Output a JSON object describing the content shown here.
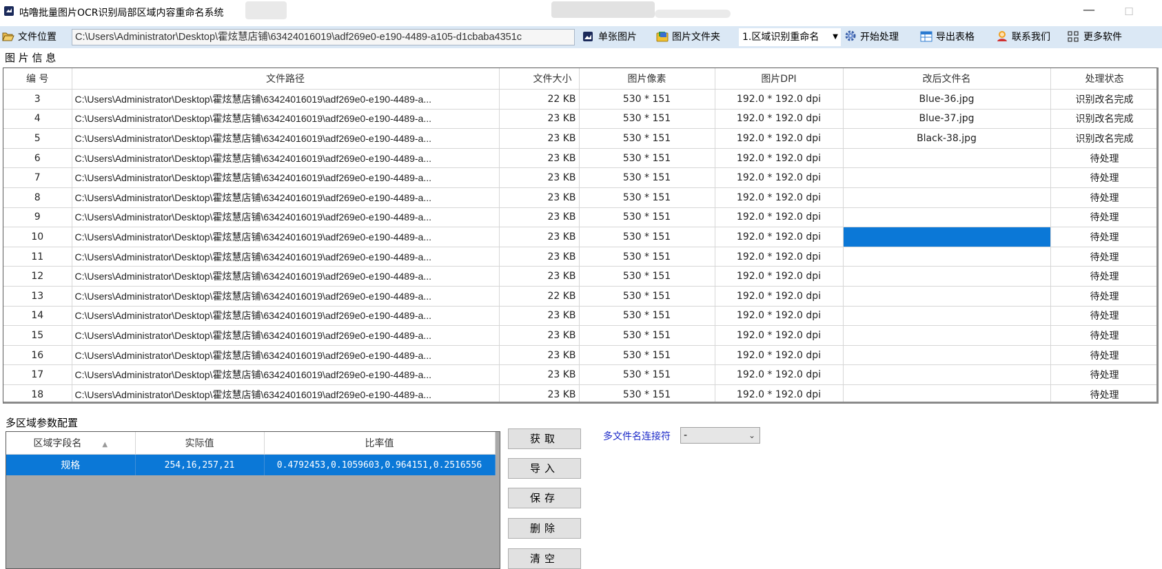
{
  "window": {
    "title": "咕噜批量图片OCR识别局部区域内容重命名系统",
    "min_glyph": "—",
    "max_glyph": "☐"
  },
  "toolbar": {
    "file_location_label": "文件位置",
    "path_value": "C:\\Users\\Administrator\\Desktop\\霍炫慧店铺\\63424016019\\adf269e0-e190-4489-a105-d1cbaba4351c",
    "single_image_label": "单张图片",
    "image_folder_label": "图片文件夹",
    "mode_value": "1.区域识别重命名",
    "start_label": "开始处理",
    "export_label": "导出表格",
    "contact_label": "联系我们",
    "more_label": "更多软件"
  },
  "image_info": {
    "section_title": "图 片 信 息",
    "columns": [
      "编 号",
      "文件路径",
      "文件大小",
      "图片像素",
      "图片DPI",
      "改后文件名",
      "处理状态"
    ],
    "rows": [
      {
        "num": "3",
        "path": "C:\\Users\\Administrator\\Desktop\\霍炫慧店铺\\63424016019\\adf269e0-e190-4489-a...",
        "size": "22 KB",
        "pixels": "530 * 151",
        "dpi": "192.0 * 192.0 dpi",
        "new_name": "Blue-36.jpg",
        "status": "识别改名完成"
      },
      {
        "num": "4",
        "path": "C:\\Users\\Administrator\\Desktop\\霍炫慧店铺\\63424016019\\adf269e0-e190-4489-a...",
        "size": "23 KB",
        "pixels": "530 * 151",
        "dpi": "192.0 * 192.0 dpi",
        "new_name": "Blue-37.jpg",
        "status": "识别改名完成"
      },
      {
        "num": "5",
        "path": "C:\\Users\\Administrator\\Desktop\\霍炫慧店铺\\63424016019\\adf269e0-e190-4489-a...",
        "size": "23 KB",
        "pixels": "530 * 151",
        "dpi": "192.0 * 192.0 dpi",
        "new_name": "Black-38.jpg",
        "status": "识别改名完成"
      },
      {
        "num": "6",
        "path": "C:\\Users\\Administrator\\Desktop\\霍炫慧店铺\\63424016019\\adf269e0-e190-4489-a...",
        "size": "23 KB",
        "pixels": "530 * 151",
        "dpi": "192.0 * 192.0 dpi",
        "new_name": "",
        "status": "待处理"
      },
      {
        "num": "7",
        "path": "C:\\Users\\Administrator\\Desktop\\霍炫慧店铺\\63424016019\\adf269e0-e190-4489-a...",
        "size": "23 KB",
        "pixels": "530 * 151",
        "dpi": "192.0 * 192.0 dpi",
        "new_name": "",
        "status": "待处理"
      },
      {
        "num": "8",
        "path": "C:\\Users\\Administrator\\Desktop\\霍炫慧店铺\\63424016019\\adf269e0-e190-4489-a...",
        "size": "23 KB",
        "pixels": "530 * 151",
        "dpi": "192.0 * 192.0 dpi",
        "new_name": "",
        "status": "待处理"
      },
      {
        "num": "9",
        "path": "C:\\Users\\Administrator\\Desktop\\霍炫慧店铺\\63424016019\\adf269e0-e190-4489-a...",
        "size": "23 KB",
        "pixels": "530 * 151",
        "dpi": "192.0 * 192.0 dpi",
        "new_name": "",
        "status": "待处理"
      },
      {
        "num": "10",
        "path": "C:\\Users\\Administrator\\Desktop\\霍炫慧店铺\\63424016019\\adf269e0-e190-4489-a...",
        "size": "23 KB",
        "pixels": "530 * 151",
        "dpi": "192.0 * 192.0 dpi",
        "new_name": "",
        "status": "待处理",
        "selected_cell": "new_name"
      },
      {
        "num": "11",
        "path": "C:\\Users\\Administrator\\Desktop\\霍炫慧店铺\\63424016019\\adf269e0-e190-4489-a...",
        "size": "23 KB",
        "pixels": "530 * 151",
        "dpi": "192.0 * 192.0 dpi",
        "new_name": "",
        "status": "待处理"
      },
      {
        "num": "12",
        "path": "C:\\Users\\Administrator\\Desktop\\霍炫慧店铺\\63424016019\\adf269e0-e190-4489-a...",
        "size": "23 KB",
        "pixels": "530 * 151",
        "dpi": "192.0 * 192.0 dpi",
        "new_name": "",
        "status": "待处理"
      },
      {
        "num": "13",
        "path": "C:\\Users\\Administrator\\Desktop\\霍炫慧店铺\\63424016019\\adf269e0-e190-4489-a...",
        "size": "22 KB",
        "pixels": "530 * 151",
        "dpi": "192.0 * 192.0 dpi",
        "new_name": "",
        "status": "待处理"
      },
      {
        "num": "14",
        "path": "C:\\Users\\Administrator\\Desktop\\霍炫慧店铺\\63424016019\\adf269e0-e190-4489-a...",
        "size": "23 KB",
        "pixels": "530 * 151",
        "dpi": "192.0 * 192.0 dpi",
        "new_name": "",
        "status": "待处理"
      },
      {
        "num": "15",
        "path": "C:\\Users\\Administrator\\Desktop\\霍炫慧店铺\\63424016019\\adf269e0-e190-4489-a...",
        "size": "23 KB",
        "pixels": "530 * 151",
        "dpi": "192.0 * 192.0 dpi",
        "new_name": "",
        "status": "待处理"
      },
      {
        "num": "16",
        "path": "C:\\Users\\Administrator\\Desktop\\霍炫慧店铺\\63424016019\\adf269e0-e190-4489-a...",
        "size": "23 KB",
        "pixels": "530 * 151",
        "dpi": "192.0 * 192.0 dpi",
        "new_name": "",
        "status": "待处理"
      },
      {
        "num": "17",
        "path": "C:\\Users\\Administrator\\Desktop\\霍炫慧店铺\\63424016019\\adf269e0-e190-4489-a...",
        "size": "23 KB",
        "pixels": "530 * 151",
        "dpi": "192.0 * 192.0 dpi",
        "new_name": "",
        "status": "待处理"
      },
      {
        "num": "18",
        "path": "C:\\Users\\Administrator\\Desktop\\霍炫慧店铺\\63424016019\\adf269e0-e190-4489-a...",
        "size": "23 KB",
        "pixels": "530 * 151",
        "dpi": "192.0 * 192.0 dpi",
        "new_name": "",
        "status": "待处理"
      }
    ]
  },
  "region_config": {
    "section_title": "多区域参数配置",
    "columns": [
      "区域字段名",
      "实际值",
      "比率值"
    ],
    "rows": [
      {
        "name": "规格",
        "actual": "254,16,257,21",
        "ratio": "0.4792453,0.1059603,0.964151,0.2516556"
      }
    ],
    "buttons": [
      "获取",
      "导入",
      "保存",
      "删除",
      "清空"
    ],
    "connector_label": "多文件名连接符",
    "connector_value": "-"
  },
  "colors": {
    "toolbar_bg": "#dbe8f5",
    "selection": "#0b78d7",
    "connector_label": "#1a28c8"
  },
  "icons": [
    "app-logo-icon",
    "open-folder-icon",
    "single-image-icon",
    "image-folder-icon",
    "gear-icon",
    "table-icon",
    "contact-icon",
    "grid-apps-icon",
    "sort-up-icon",
    "dropdown-arrow-icon"
  ]
}
